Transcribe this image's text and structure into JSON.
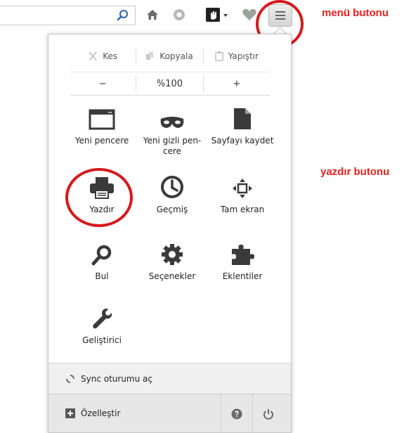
{
  "toolbar": {
    "url_value": "",
    "icons": [
      "search-icon",
      "home-icon",
      "pocket-icon",
      "addon-icon",
      "bookmark-icon",
      "menu-icon"
    ]
  },
  "annotations": {
    "menu_button": "menü butonu",
    "print_button": "yazdır butonu",
    "color": "#e8211d"
  },
  "edit": {
    "cut": "Kes",
    "copy": "Kopyala",
    "paste": "Yapıştır"
  },
  "zoom": {
    "minus": "−",
    "value": "%100",
    "plus": "+"
  },
  "items": [
    {
      "label": "Yeni pencere",
      "icon": "window-icon"
    },
    {
      "label": "Yeni gizli pen-cere",
      "icon": "mask-icon"
    },
    {
      "label": "Sayfayı kaydet",
      "icon": "page-icon"
    },
    {
      "label": "Yazdır",
      "icon": "printer-icon"
    },
    {
      "label": "Geçmiş",
      "icon": "clock-icon"
    },
    {
      "label": "Tam ekran",
      "icon": "fullscreen-icon"
    },
    {
      "label": "Bul",
      "icon": "magnifier-icon"
    },
    {
      "label": "Seçenekler",
      "icon": "gear-icon"
    },
    {
      "label": "Eklentiler",
      "icon": "puzzle-icon"
    },
    {
      "label": "Geliştirici",
      "icon": "wrench-icon"
    }
  ],
  "sync": {
    "label": "Sync oturumu aç"
  },
  "footer": {
    "customize": "Özelleştir"
  }
}
